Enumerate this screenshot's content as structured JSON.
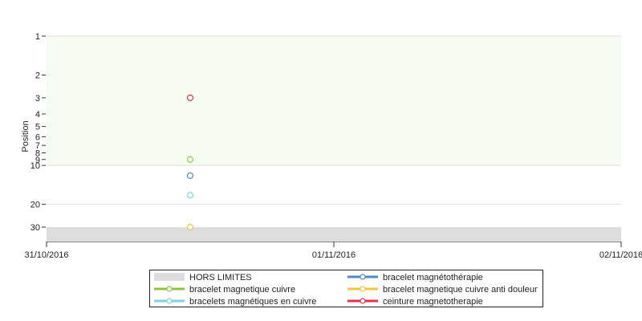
{
  "chart_data": {
    "type": "scatter",
    "ylabel": "Position",
    "y_scale": "log",
    "y_reversed": true,
    "ylim": [
      1,
      30
    ],
    "y_ticks": [
      "1",
      "2",
      "3",
      "4",
      "5",
      "6",
      "7",
      "8",
      "9",
      "10",
      "20",
      "30"
    ],
    "x_ticks": [
      "31/10/2016",
      "01/11/2016",
      "02/11/2016"
    ],
    "x_point_fraction": 0.25,
    "bands": [
      {
        "name": "top10",
        "from": 1,
        "to": 10,
        "color": "#f6fdf0"
      },
      {
        "name": "hors-limites",
        "from": 30,
        "to": 36,
        "color": "#dddddd"
      }
    ],
    "series": [
      {
        "name": "HORS LIMITES",
        "kind": "band",
        "color": "#dddddd"
      },
      {
        "name": "bracelet magnétothérapie",
        "color": "#4f8bc4",
        "values": [
          12
        ]
      },
      {
        "name": "bracelet magnetique cuivre",
        "color": "#8cc63f",
        "values": [
          9
        ]
      },
      {
        "name": "bracelet magnetique cuivre anti douleur",
        "color": "#f5c342",
        "values": [
          30
        ]
      },
      {
        "name": "bracelets magnétiques en cuivre",
        "color": "#7fd0e0",
        "values": [
          17
        ]
      },
      {
        "name": "ceinture magnetotherapie",
        "color": "#e8304d",
        "values": [
          3
        ]
      }
    ],
    "legend_position": "bottom"
  }
}
